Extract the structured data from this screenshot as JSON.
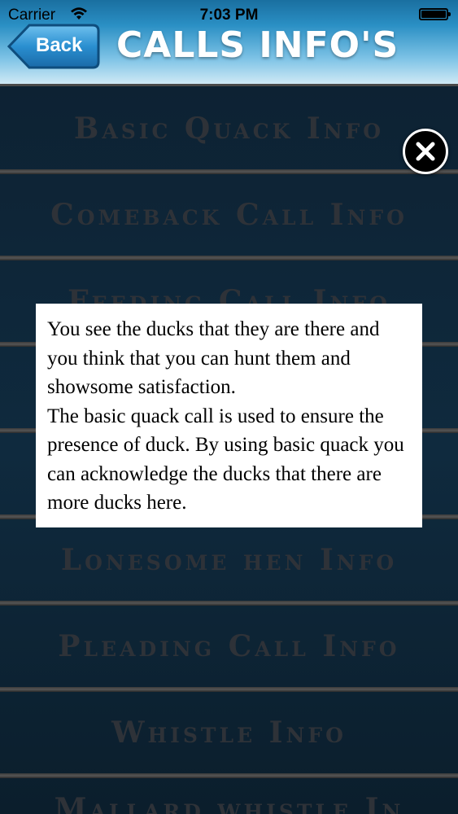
{
  "status_bar": {
    "carrier": "Carrier",
    "time": "7:03 PM",
    "battery_level": 1.0
  },
  "nav": {
    "back_label": "Back",
    "title": "CALLS INFO'S"
  },
  "list": {
    "items": [
      {
        "label": "Basic Quack Info"
      },
      {
        "label": "Comeback Call Info"
      },
      {
        "label": "Feeding Call Info"
      },
      {
        "label": ""
      },
      {
        "label": ""
      },
      {
        "label": "Lonesome hen Info"
      },
      {
        "label": "Pleading Call Info"
      },
      {
        "label": "Whistle Info"
      },
      {
        "label": "Mallard whistle In"
      }
    ]
  },
  "popup": {
    "text": "You see the ducks that they are there and you think that you can hunt them and showsome satisfaction.\nThe basic quack call is used to ensure the presence of duck. By using basic quack you can acknowledge the ducks that there are more ducks here."
  },
  "colors": {
    "nav_top": "#1a6fa0",
    "nav_bottom": "#cfe9f5",
    "list_bg": "#0f2a3e",
    "list_text": "#2e3238"
  }
}
